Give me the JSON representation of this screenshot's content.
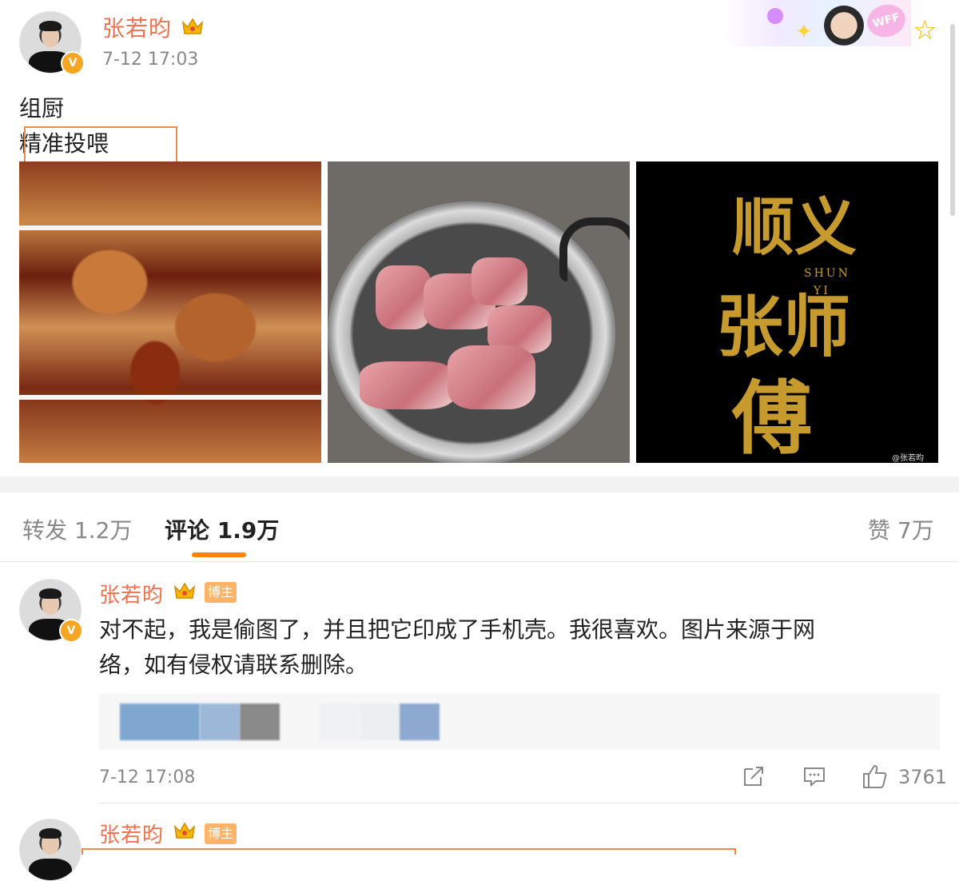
{
  "post": {
    "author": "张若昀",
    "timestamp": "7-12 17:03",
    "text_line1": "组厨",
    "text_line2": "精准投喂",
    "banner_badge": "WFF",
    "images": {
      "title_card_main": "顺义",
      "title_card_name": "张师",
      "title_card_last": "傅",
      "title_card_pinyin1": "SHUN",
      "title_card_pinyin2": "YI",
      "title_card_watermark": "@张若昀"
    }
  },
  "tabs": {
    "repost": "转发 1.2万",
    "comments": "评论 1.9万",
    "likes": "赞 7万"
  },
  "comments": [
    {
      "author": "张若昀",
      "tag": "博主",
      "text_line1": "对不起，我是偷图了，并且把它印成了手机壳。我很喜欢。图片来源于网",
      "text_line2": "络，如有侵权请联系删除。",
      "time": "7-12 17:08",
      "like_count": "3761"
    },
    {
      "author": "张若昀",
      "tag": "博主"
    }
  ],
  "icons": {
    "verified": "V",
    "share": "share-icon",
    "reply": "comment-icon",
    "like": "thumb-up-icon",
    "favorite": "star-icon"
  },
  "colors": {
    "username": "#eb7350",
    "tab_accent": "#ff8200",
    "highlight": "#ec8b4a",
    "tag_bg": "#ffb366"
  }
}
